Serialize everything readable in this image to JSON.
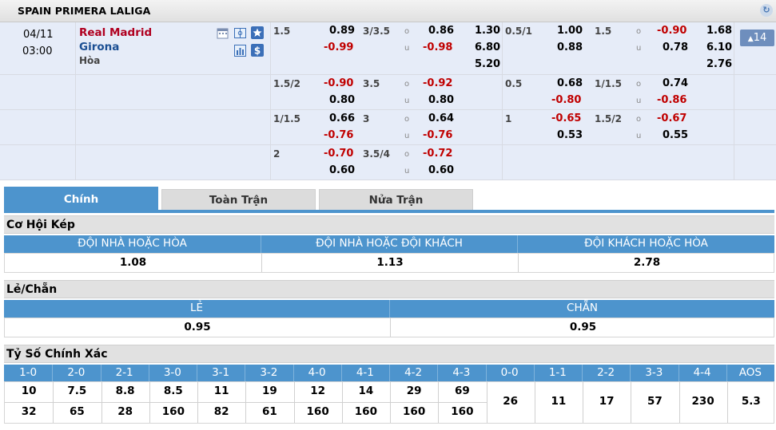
{
  "league": "SPAIN PRIMERA LALIGA",
  "match": {
    "date": "04/11",
    "time": "03:00",
    "home": "Real Madrid",
    "away": "Girona",
    "draw_label": "Hòa",
    "more_count": "14"
  },
  "odds_rows": [
    {
      "h1": "1.5",
      "h1a": "0.89",
      "h1b": "-0.99",
      "ou1": "3/3.5",
      "ou1a": "0.86",
      "ou1b": "-0.98",
      "x1": "1.30",
      "x2": "6.80",
      "x3": "5.20",
      "h2": "0.5/1",
      "h2a": "1.00",
      "h2b": "0.88",
      "ou2": "1.5",
      "ou2a": "-0.90",
      "ou2b": "0.78",
      "y1": "1.68",
      "y2": "6.10",
      "y3": "2.76"
    },
    {
      "h1": "1.5/2",
      "h1a": "-0.90",
      "h1b": "0.80",
      "ou1": "3.5",
      "ou1a": "-0.92",
      "ou1b": "0.80",
      "h2": "0.5",
      "h2a": "0.68",
      "h2b": "-0.80",
      "ou2": "1/1.5",
      "ou2a": "0.74",
      "ou2b": "-0.86"
    },
    {
      "h1": "1/1.5",
      "h1a": "0.66",
      "h1b": "-0.76",
      "ou1": "3",
      "ou1a": "0.64",
      "ou1b": "-0.76",
      "h2": "1",
      "h2a": "-0.65",
      "h2b": "0.53",
      "ou2": "1.5/2",
      "ou2a": "-0.67",
      "ou2b": "0.55"
    },
    {
      "h1": "2",
      "h1a": "-0.70",
      "h1b": "0.60",
      "ou1": "3.5/4",
      "ou1a": "-0.72",
      "ou1b": "0.60"
    }
  ],
  "ou_labels": {
    "over": "o",
    "under": "u"
  },
  "tabs": [
    "Chính",
    "Toàn Trận",
    "Nửa Trận"
  ],
  "double_chance": {
    "title": "Cơ Hội Kép",
    "headers": [
      "ĐỘI NHÀ HOẶC HÒA",
      "ĐỘI NHÀ HOẶC ĐỘI KHÁCH",
      "ĐỘI KHÁCH HOẶC HÒA"
    ],
    "values": [
      "1.08",
      "1.13",
      "2.78"
    ]
  },
  "odd_even": {
    "title": "Lẻ/Chẵn",
    "headers": [
      "LẺ",
      "CHẴN"
    ],
    "values": [
      "0.95",
      "0.95"
    ]
  },
  "correct_score": {
    "title": "Tỷ Số Chính Xác",
    "headers": [
      "1-0",
      "2-0",
      "2-1",
      "3-0",
      "3-1",
      "3-2",
      "4-0",
      "4-1",
      "4-2",
      "4-3",
      "0-0",
      "1-1",
      "2-2",
      "3-3",
      "4-4",
      "AOS"
    ],
    "home_row": [
      "10",
      "7.5",
      "8.8",
      "8.5",
      "11",
      "19",
      "12",
      "14",
      "29",
      "69"
    ],
    "away_row": [
      "32",
      "65",
      "28",
      "160",
      "82",
      "61",
      "160",
      "160",
      "160",
      "160"
    ],
    "draws": [
      "26",
      "11",
      "17",
      "57",
      "230",
      "5.3"
    ]
  },
  "colors": {
    "accent": "#4d94cd",
    "home": "#b00020",
    "away": "#1b4f93",
    "negative": "#c00000"
  }
}
